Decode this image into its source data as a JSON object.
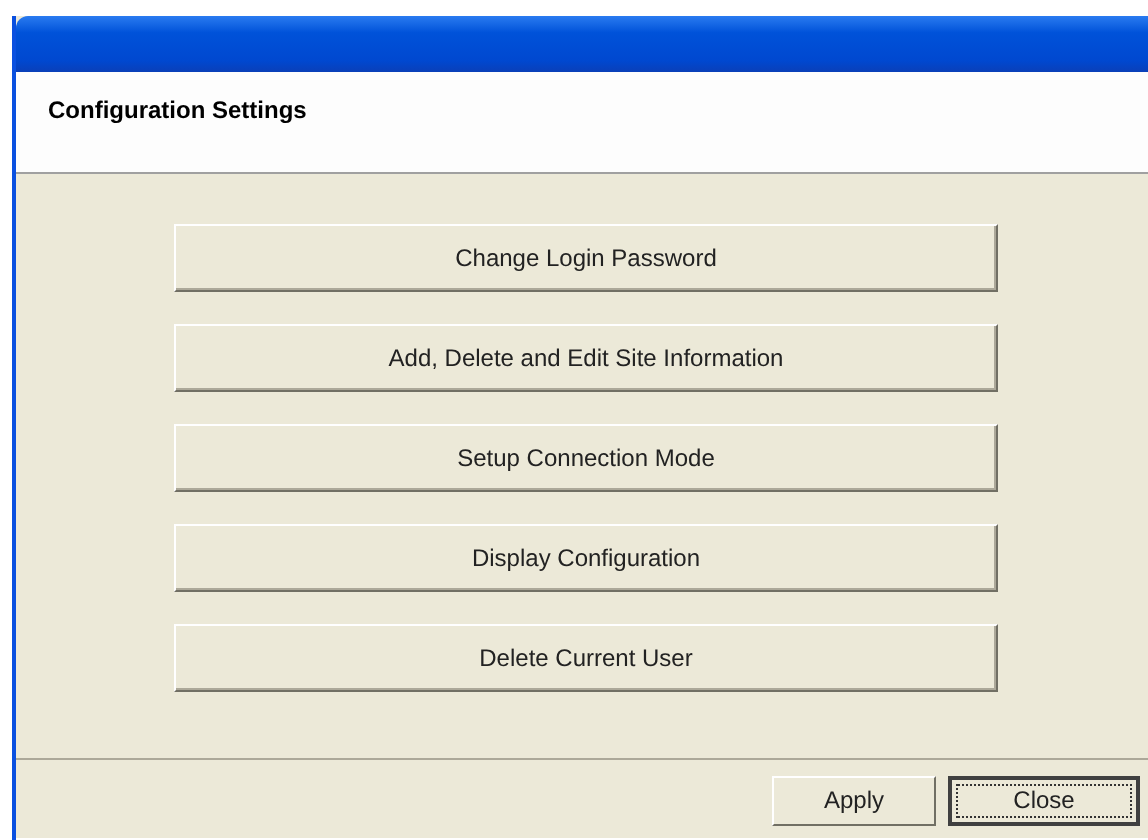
{
  "window": {
    "title": "Configuration Settings"
  },
  "options": [
    {
      "label": "Change Login Password"
    },
    {
      "label": "Add, Delete and Edit Site Information"
    },
    {
      "label": "Setup Connection Mode"
    },
    {
      "label": "Display Configuration"
    },
    {
      "label": "Delete Current User"
    }
  ],
  "buttons": [
    {
      "label": "Apply",
      "default": false
    },
    {
      "label": "Close",
      "default": true
    }
  ]
}
